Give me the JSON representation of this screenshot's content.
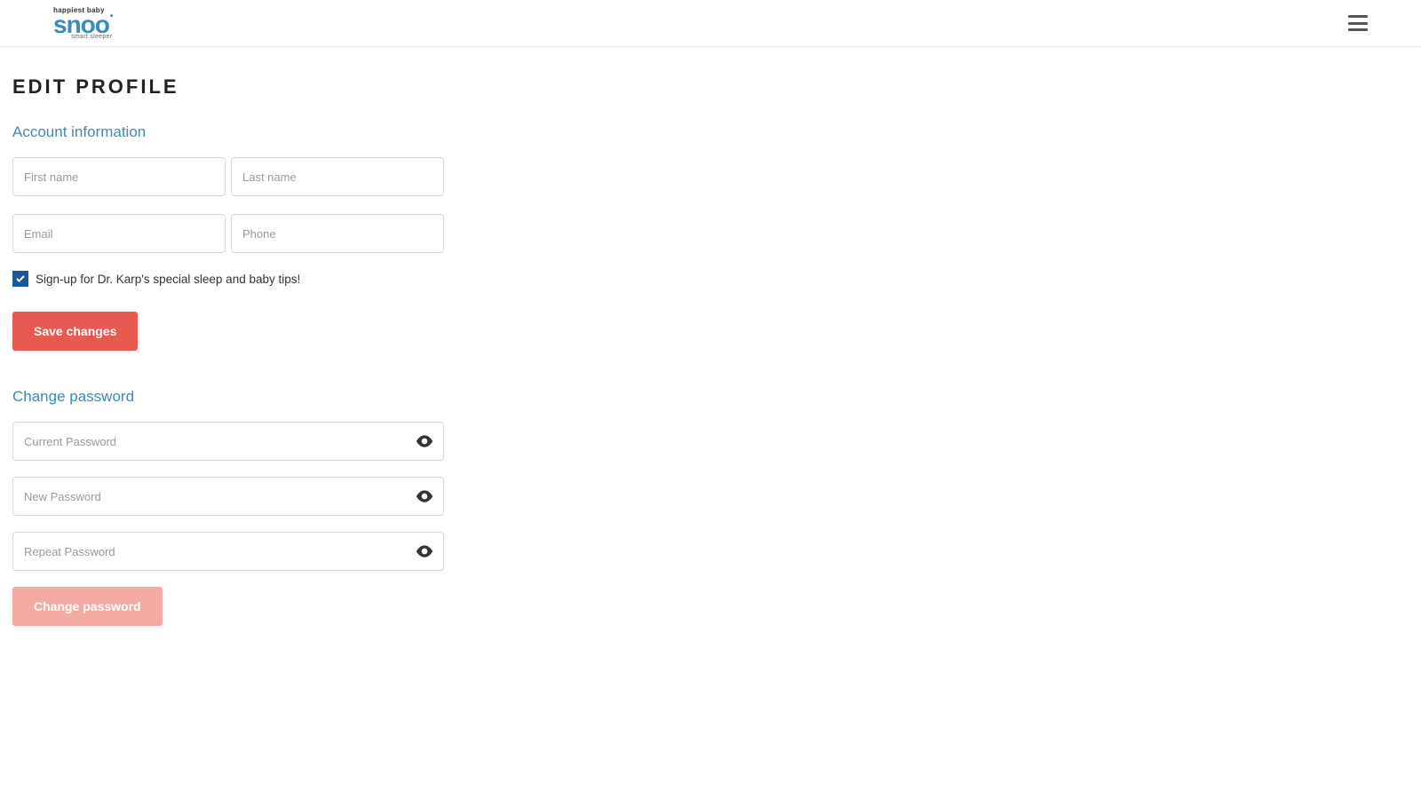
{
  "logo": {
    "top": "happiest baby",
    "main": "snoo",
    "sub": "smart sleeper"
  },
  "page": {
    "title": "EDIT PROFILE"
  },
  "account": {
    "section_title": "Account information",
    "first_name_placeholder": "First name",
    "last_name_placeholder": "Last name",
    "email_placeholder": "Email",
    "phone_placeholder": "Phone",
    "signup_checked": true,
    "signup_label": "Sign-up for Dr. Karp's special sleep and baby tips!",
    "save_label": "Save changes"
  },
  "password": {
    "section_title": "Change password",
    "current_placeholder": "Current Password",
    "new_placeholder": "New Password",
    "repeat_placeholder": "Repeat Password",
    "change_label": "Change password"
  }
}
